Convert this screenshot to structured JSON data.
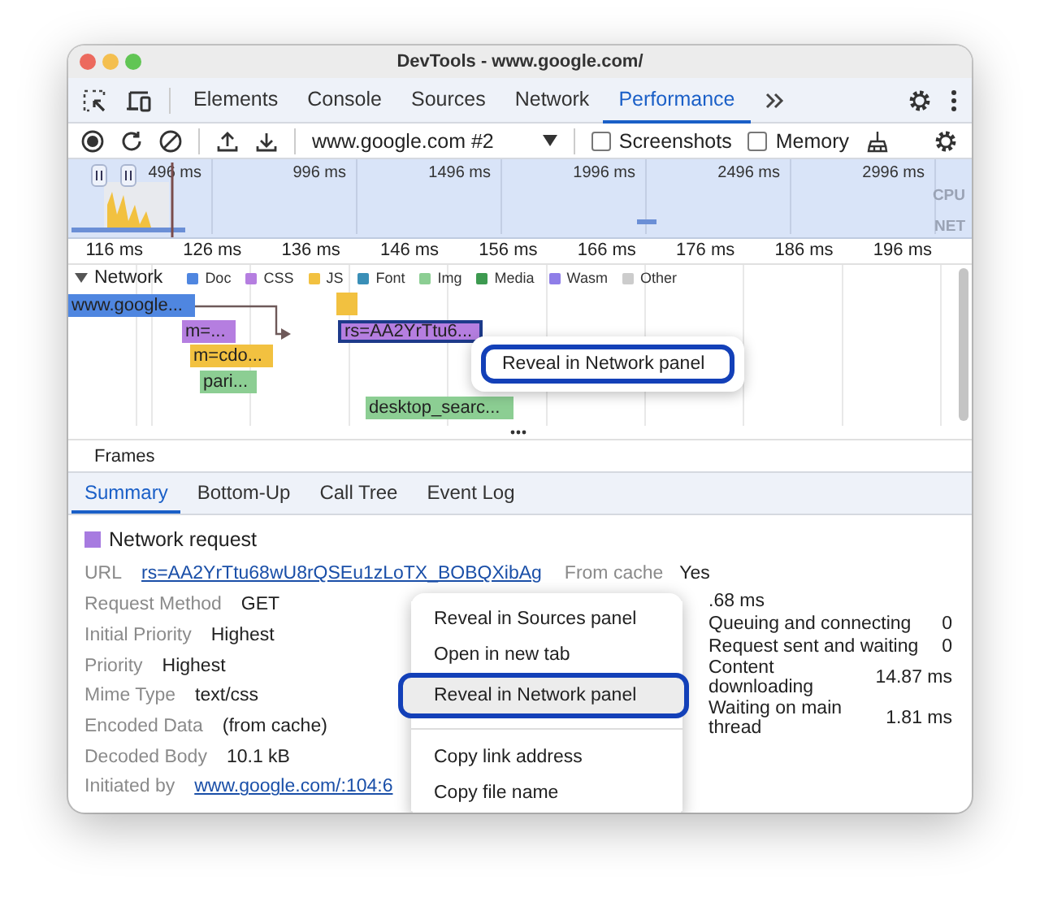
{
  "window": {
    "title": "DevTools - www.google.com/"
  },
  "tabs": [
    {
      "label": "Elements",
      "selected": false
    },
    {
      "label": "Console",
      "selected": false
    },
    {
      "label": "Sources",
      "selected": false
    },
    {
      "label": "Network",
      "selected": false
    },
    {
      "label": "Performance",
      "selected": true
    }
  ],
  "toolbar": {
    "recording": "www.google.com #2",
    "checkboxes": [
      {
        "label": "Screenshots",
        "checked": false
      },
      {
        "label": "Memory",
        "checked": false
      }
    ]
  },
  "overview": {
    "ticks": [
      "496 ms",
      "996 ms",
      "1496 ms",
      "1996 ms",
      "2496 ms",
      "2996 ms"
    ],
    "lanes": [
      "CPU",
      "NET"
    ]
  },
  "timeline": {
    "ticks": [
      "116 ms",
      "126 ms",
      "136 ms",
      "146 ms",
      "156 ms",
      "166 ms",
      "176 ms",
      "186 ms",
      "196 ms"
    ],
    "network": {
      "label": "Network",
      "expanded": true,
      "legend": [
        {
          "label": "Doc",
          "color": "#4f86e0"
        },
        {
          "label": "CSS",
          "color": "#b57ee0"
        },
        {
          "label": "JS",
          "color": "#f2c140"
        },
        {
          "label": "Font",
          "color": "#3a8fb7"
        },
        {
          "label": "Img",
          "color": "#8cce93"
        },
        {
          "label": "Media",
          "color": "#3d9a50"
        },
        {
          "label": "Wasm",
          "color": "#8f7ee8"
        },
        {
          "label": "Other",
          "color": "#cccccc"
        }
      ],
      "requests": [
        {
          "label": "www.google...",
          "color": "#4f86e0",
          "selected": false
        },
        {
          "color": "#f2c140",
          "selected": false
        },
        {
          "label": "m=...",
          "color": "#b57ee0",
          "selected": false
        },
        {
          "label": "rs=AA2YrTtu6...",
          "color": "#b57ee0",
          "selected": true
        },
        {
          "label": "m=cdo...",
          "color": "#f2c140",
          "selected": false
        },
        {
          "label": "pari...",
          "color": "#8cce93",
          "selected": false
        },
        {
          "label": "desktop_searc...",
          "color": "#8cce93",
          "selected": false
        }
      ]
    },
    "popup": {
      "label": "Reveal in Network panel",
      "highlighted": true
    },
    "frames_label": "Frames"
  },
  "details_tabs": [
    {
      "label": "Summary",
      "selected": true
    },
    {
      "label": "Bottom-Up",
      "selected": false
    },
    {
      "label": "Call Tree",
      "selected": false
    },
    {
      "label": "Event Log",
      "selected": false
    }
  ],
  "summary": {
    "title": "Network request",
    "url": {
      "label": "URL",
      "value": "rs=AA2YrTtu68wU8rQSEu1zLoTX_BOBQXibAg"
    },
    "from_cache": {
      "label": "From cache",
      "value": "Yes"
    },
    "fields": [
      {
        "label": "Request Method",
        "value": "GET",
        "kind": "text"
      },
      {
        "label": "Initial Priority",
        "value": "Highest",
        "kind": "text"
      },
      {
        "label": "Priority",
        "value": "Highest",
        "kind": "text"
      },
      {
        "label": "Mime Type",
        "value": "text/css",
        "kind": "text"
      },
      {
        "label": "Encoded Data",
        "value": "(from cache)",
        "kind": "text"
      },
      {
        "label": "Decoded Body",
        "value": "10.1 kB",
        "kind": "text"
      },
      {
        "label": "Initiated by",
        "value": "www.google.com/:104:6",
        "kind": "link"
      }
    ],
    "duration": ".68 ms",
    "timing": [
      {
        "label": "Queuing and connecting",
        "value": "0"
      },
      {
        "label": "Request sent and waiting",
        "value": "0"
      },
      {
        "label": "Content downloading",
        "value": "14.87 ms"
      },
      {
        "label": "Waiting on main thread",
        "value": "1.81 ms"
      }
    ]
  },
  "context_menu": {
    "groups": [
      [
        {
          "label": "Reveal in Sources panel",
          "highlighted": false
        },
        {
          "label": "Open in new tab",
          "highlighted": false
        },
        {
          "label": "Reveal in Network panel",
          "highlighted": true
        }
      ],
      [
        {
          "label": "Copy link address",
          "highlighted": false
        },
        {
          "label": "Copy file name",
          "highlighted": false
        }
      ]
    ]
  }
}
